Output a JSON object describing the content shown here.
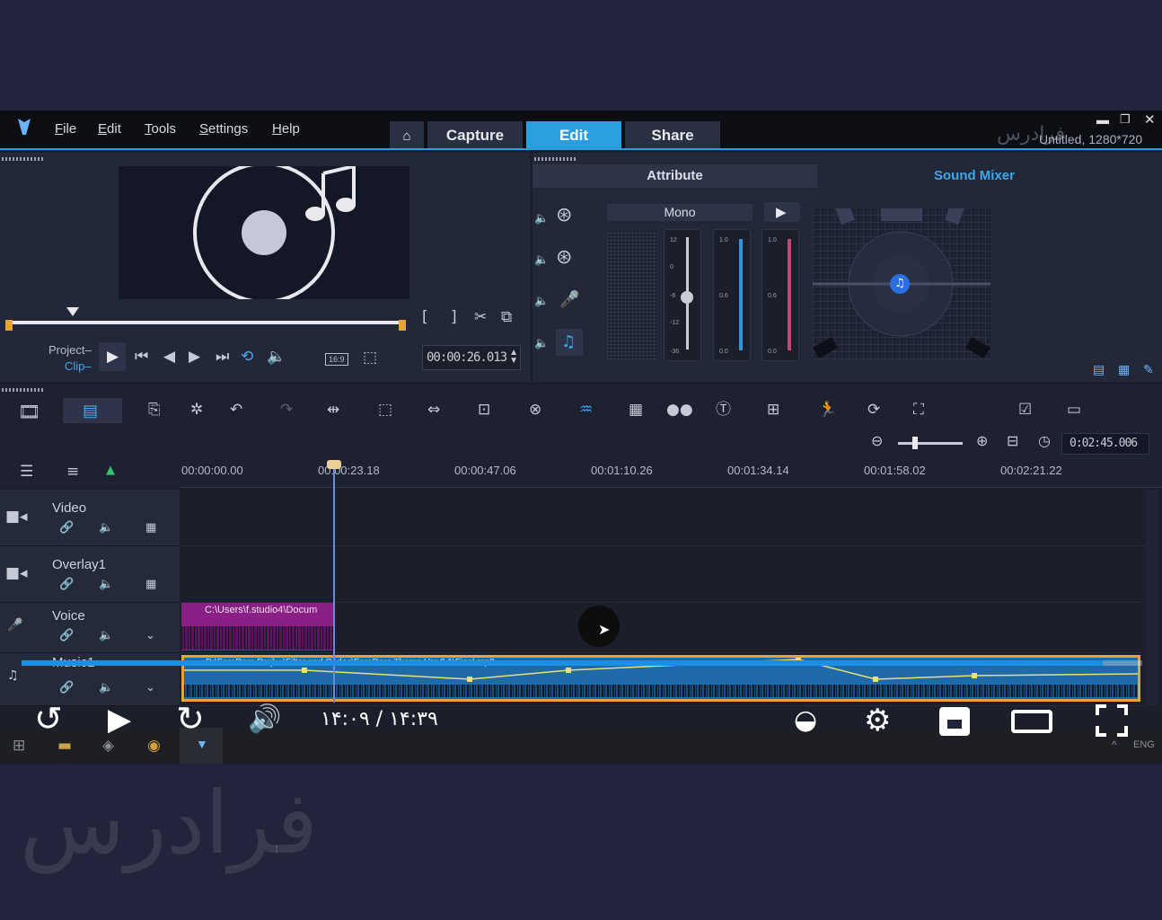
{
  "menu": {
    "file": "File",
    "edit": "Edit",
    "tools": "Tools",
    "settings": "Settings",
    "help": "Help"
  },
  "tabs": {
    "capture": "Capture",
    "edit": "Edit",
    "share": "Share"
  },
  "project_info": "Untitled, 1280*720",
  "watermark_top": "فرادرس",
  "watermark_bottom": "فرادرس",
  "preview": {
    "project_label": "Project–",
    "clip_label": "Clip–",
    "timecode": "00:00:26.013",
    "aspect": "16:9"
  },
  "mixer": {
    "tab_attribute": "Attribute",
    "tab_sound_mixer": "Sound Mixer",
    "mode": "Mono",
    "scale_a": [
      "12",
      "0",
      "-6",
      "-12",
      "-36"
    ],
    "scale_b": [
      "1.0",
      "0.6",
      "0.0"
    ]
  },
  "timeline": {
    "duration": "0:02:45.006",
    "ruler": [
      "00:00:00.00",
      "00:00:23.18",
      "00:00:47.06",
      "00:01:10.26",
      "00:01:34.14",
      "00:01:58.02",
      "00:02:21.22"
    ],
    "tracks": [
      {
        "name": "Video"
      },
      {
        "name": "Overlay1"
      },
      {
        "name": "Voice"
      },
      {
        "name": "Music1"
      }
    ],
    "voice_clip": "C:\\Users\\f.studio4\\Docum",
    "music_clip": "D:\\FaraDars Proj\\...\\Filter and Codec\\FaraDars Theme Ver 2.1\\Final.mp3"
  },
  "player": {
    "time": "۱۴:۰۹ / ۱۴:۳۹",
    "progress": 0.965
  },
  "taskbar": {
    "lang": "ENG"
  },
  "colors": {
    "accent": "#2a9fe0",
    "progress": "#1a8fe6",
    "voice_clip": "#8a1f86",
    "music_clip": "#1f6aa8"
  }
}
